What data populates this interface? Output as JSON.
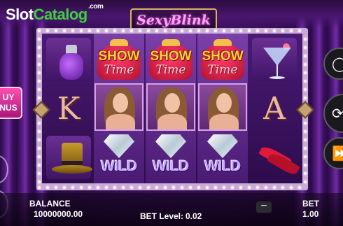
{
  "watermark": {
    "slot": "Slot",
    "catalog": "Catalog",
    "com": ".com"
  },
  "game": {
    "title": "SexyBlink"
  },
  "reels": [
    [
      "perfume",
      "K",
      "top-hat"
    ],
    [
      "show-time",
      "woman",
      "wild"
    ],
    [
      "show-time",
      "woman",
      "wild"
    ],
    [
      "show-time",
      "woman",
      "wild"
    ],
    [
      "martini",
      "A",
      "red-heels"
    ]
  ],
  "symbols": {
    "show_time_line1": "SHOW",
    "show_time_line2": "Time",
    "wild": "WILD",
    "k": "K",
    "a": "A"
  },
  "buy_bonus": {
    "line1": "UY",
    "line2": "NUS"
  },
  "bottom": {
    "balance_label": "BALANCE",
    "balance_value": "10000000.00",
    "bet_level_label": "BET Level:",
    "bet_level_value": "0.02",
    "bet_label": "BET",
    "bet_value": "1.00",
    "minus": "−"
  },
  "controls": {
    "spin_icon": "refresh-icon",
    "autoplay_icon": "fast-forward-icon",
    "menu_icon": "menu-icon"
  }
}
